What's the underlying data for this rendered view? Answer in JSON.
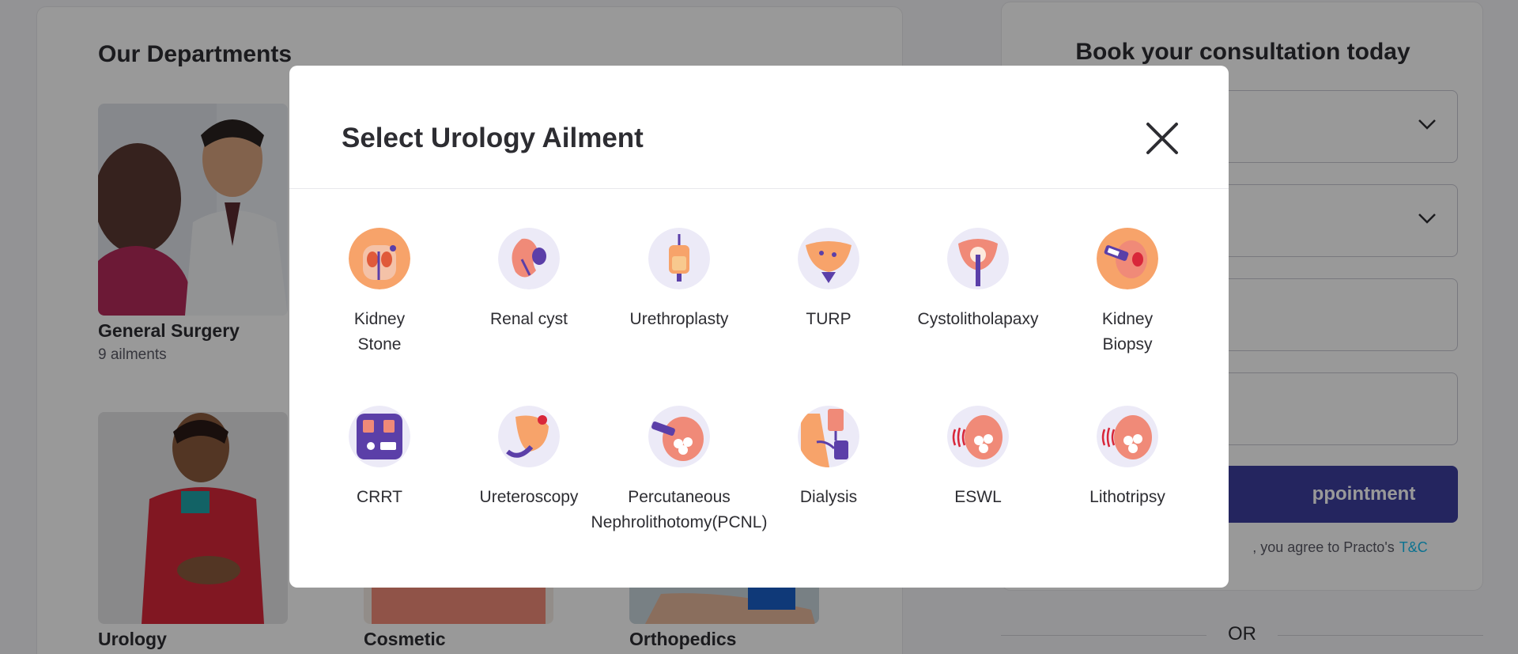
{
  "background": {
    "departments_title": "Our Departments",
    "departments": [
      {
        "name": "General Surgery",
        "count": "9 ailments"
      },
      {
        "name": "Urology",
        "count": ""
      },
      {
        "name": "Cosmetic",
        "count": ""
      },
      {
        "name": "Orthopedics",
        "count": ""
      }
    ],
    "booking": {
      "title": "Book your consultation today",
      "button_label": "ppointment",
      "tnc_text": ", you agree to Practo's",
      "tnc_link": "T&C",
      "or_label": "OR"
    }
  },
  "modal": {
    "title": "Select Urology Ailment",
    "close_icon": "close-icon",
    "ailments": [
      {
        "label": "Kidney Stone",
        "icon": "kidney-stone-icon"
      },
      {
        "label": "Renal cyst",
        "icon": "renal-cyst-icon"
      },
      {
        "label": "Urethroplasty",
        "icon": "urethroplasty-icon"
      },
      {
        "label": "TURP",
        "icon": "turp-icon"
      },
      {
        "label": "Cystolitholapaxy",
        "icon": "cystolitholapaxy-icon"
      },
      {
        "label": "Kidney Biopsy",
        "icon": "kidney-biopsy-icon"
      },
      {
        "label": "CRRT",
        "icon": "crrt-icon"
      },
      {
        "label": "Ureteroscopy",
        "icon": "ureteroscopy-icon"
      },
      {
        "label": "Percutaneous Nephrolithotomy(PCNL)",
        "icon": "pcnl-icon"
      },
      {
        "label": "Dialysis",
        "icon": "dialysis-icon"
      },
      {
        "label": "ESWL",
        "icon": "eswl-icon"
      },
      {
        "label": "Lithotripsy",
        "icon": "lithotripsy-icon"
      }
    ]
  },
  "colors": {
    "primary_button": "#3c3f9f",
    "link": "#14bef0",
    "icon_orange": "#f7a36a",
    "icon_purple": "#5b3fa8",
    "icon_bg": "#eceaf7"
  }
}
